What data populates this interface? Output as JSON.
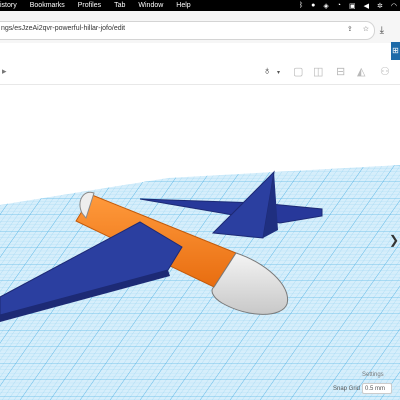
{
  "menubar": {
    "items": [
      "istory",
      "Bookmarks",
      "Profiles",
      "Tab",
      "Window",
      "Help"
    ],
    "status_icons": [
      "bluetooth-icon",
      "circle-icon",
      "shield-icon",
      "wifi-icon",
      "control-center-icon",
      "volume-icon",
      "gear-icon",
      "wifi-icon"
    ]
  },
  "browser": {
    "url": "ngs/esJzeAi2qvr-powerful-hillar-jofo/edit"
  },
  "toolbar": {
    "tools": [
      "lightbulb-icon",
      "group-icon",
      "ungroup-icon",
      "align-icon",
      "mirror-icon",
      "cruise-icon"
    ]
  },
  "workplane": {
    "settings_label": "Settings",
    "snap_grid_label": "Snap Grid",
    "snap_grid_value": "0.5 mm"
  },
  "colors": {
    "grid": "#bfe3f7",
    "fuselage": "#f47b20",
    "wing": "#2b3fa0",
    "nose": "#e8e8e8"
  }
}
